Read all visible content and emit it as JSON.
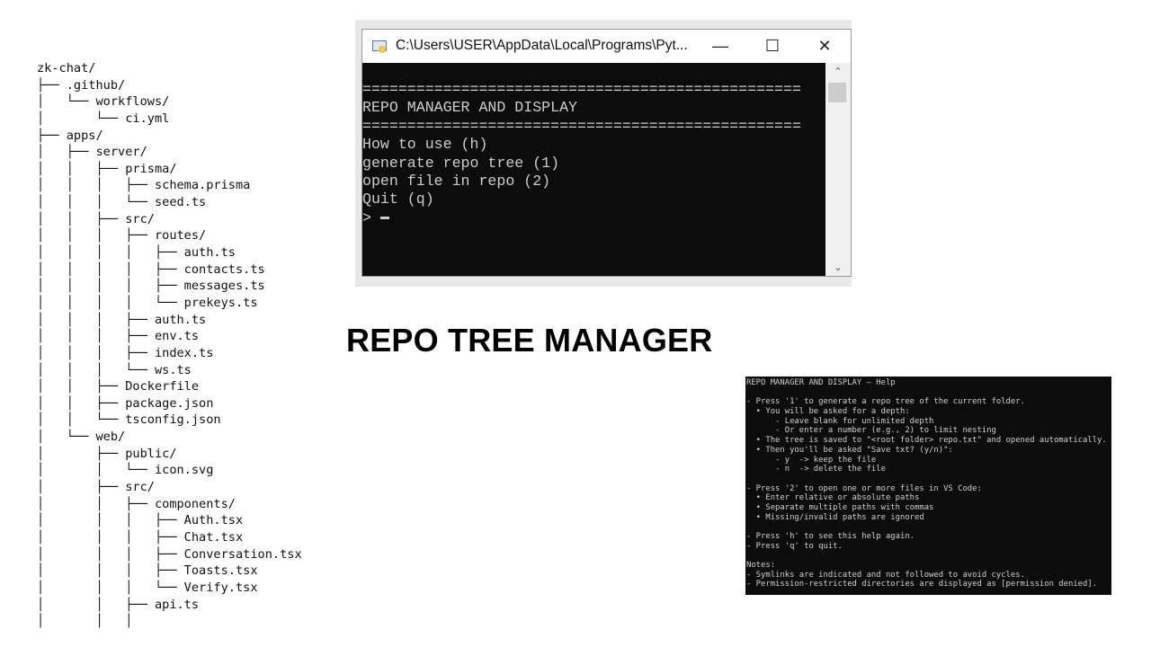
{
  "tree": {
    "lines": [
      "zk-chat/",
      "├── .github/",
      "│   └── workflows/",
      "│       └── ci.yml",
      "├── apps/",
      "│   ├── server/",
      "│   │   ├── prisma/",
      "│   │   │   ├── schema.prisma",
      "│   │   │   └── seed.ts",
      "│   │   ├── src/",
      "│   │   │   ├── routes/",
      "│   │   │   │   ├── auth.ts",
      "│   │   │   │   ├── contacts.ts",
      "│   │   │   │   ├── messages.ts",
      "│   │   │   │   └── prekeys.ts",
      "│   │   │   ├── auth.ts",
      "│   │   │   ├── env.ts",
      "│   │   │   ├── index.ts",
      "│   │   │   └── ws.ts",
      "│   │   ├── Dockerfile",
      "│   │   ├── package.json",
      "│   │   └── tsconfig.json",
      "│   └── web/",
      "│       ├── public/",
      "│       │   └── icon.svg",
      "│       ├── src/",
      "│       │   ├── components/",
      "│       │   │   ├── Auth.tsx",
      "│       │   │   ├── Chat.tsx",
      "│       │   │   ├── Conversation.tsx",
      "│       │   │   ├── Toasts.tsx",
      "│       │   │   └── Verify.tsx",
      "│       │   ├── api.ts",
      "│       │   │"
    ]
  },
  "window": {
    "title": "C:\\Users\\USER\\AppData\\Local\\Programs\\Pyt...",
    "minimize": "—",
    "maximize": "☐",
    "close": "✕",
    "scroll_up": "⌃",
    "scroll_down": "⌄"
  },
  "console": {
    "lines": [
      "=================================================",
      "REPO MANAGER AND DISPLAY",
      "=================================================",
      "How to use (h)",
      "generate repo tree (1)",
      "open file in repo (2)",
      "Quit (q)"
    ],
    "prompt": ">"
  },
  "main_title": "REPO TREE MANAGER",
  "help": {
    "lines": [
      "REPO MANAGER AND DISPLAY — Help",
      "",
      "- Press '1' to generate a repo tree of the current folder.",
      "  • You will be asked for a depth:",
      "      - Leave blank for unlimited depth",
      "      - Or enter a number (e.g., 2) to limit nesting",
      "  • The tree is saved to \"<root folder> repo.txt\" and opened automatically.",
      "  • Then you'll be asked \"Save txt? (y/n)\":",
      "      - y  -> keep the file",
      "      - n  -> delete the file",
      "",
      "- Press '2' to open one or more files in VS Code:",
      "  • Enter relative or absolute paths",
      "  • Separate multiple paths with commas",
      "  • Missing/invalid paths are ignored",
      "",
      "- Press 'h' to see this help again.",
      "- Press 'q' to quit.",
      "",
      "Notes:",
      "- Symlinks are indicated and not followed to avoid cycles.",
      "- Permission-restricted directories are displayed as [permission denied]."
    ]
  }
}
